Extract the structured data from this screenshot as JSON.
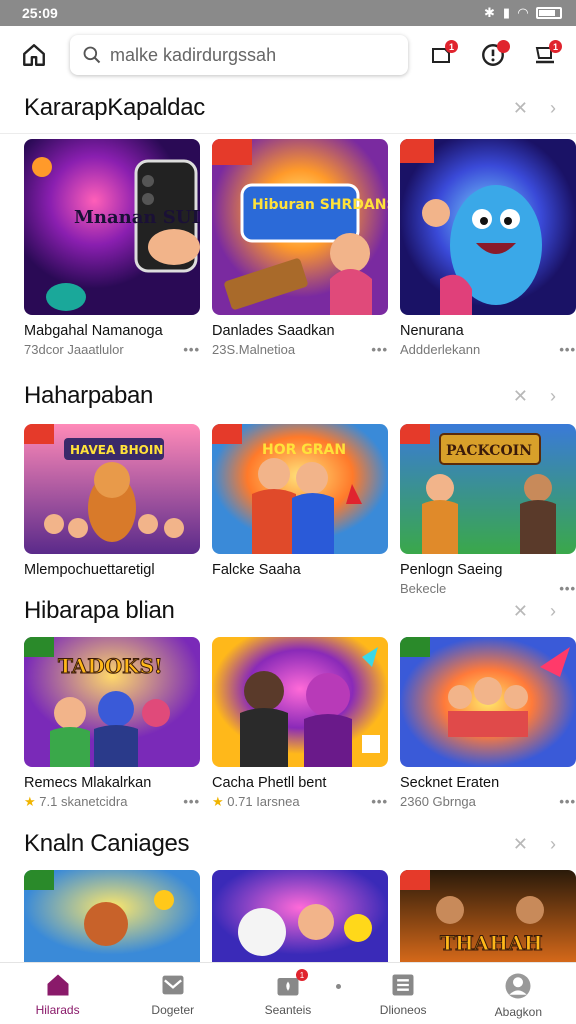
{
  "status_bar": {
    "time": "25:09"
  },
  "search": {
    "placeholder": "malke kadirdurgssah"
  },
  "top_actions": [
    {
      "icon": "inbox-icon",
      "badge": "1"
    },
    {
      "icon": "notification-icon",
      "badge": ""
    },
    {
      "icon": "cart-icon",
      "badge": "1"
    }
  ],
  "sections": [
    {
      "title": "KararapKapaldac",
      "cards": [
        {
          "title": "Mabgahal Namanoga",
          "meta": "73dcor Jaaatlulor",
          "badge_text": "Mnanan SUDAICI"
        },
        {
          "title": "Danlades Saadkan",
          "meta": "23S.Malnetioa",
          "badge_text": "Hiburan SHRDANS"
        },
        {
          "title": "Nenurana",
          "meta": "Addderlekann",
          "badge_text": ""
        }
      ]
    },
    {
      "title": "Haharpaban",
      "cards": [
        {
          "title": "Mlempochuettaretigl",
          "meta": "",
          "badge_text": "HAVEA BHOIN"
        },
        {
          "title": "Falcke Saaha",
          "meta": "",
          "badge_text": "HOR GRAN"
        },
        {
          "title": "Penlogn Saeing",
          "meta": "Bekecle",
          "badge_text": "PACKCOIN"
        }
      ]
    },
    {
      "title": "Hibarapa blian",
      "cards": [
        {
          "title": "Remecs Mlakalrkan",
          "meta": "7.1 skanetcidra",
          "rating": true,
          "badge_text": "TADOKS!"
        },
        {
          "title": "Cacha Phetll bent",
          "meta": "0.71 Iarsnea",
          "rating": true,
          "badge_text": ""
        },
        {
          "title": "Secknet Eraten",
          "meta": "2360 Gbrnga",
          "badge_text": ""
        }
      ]
    },
    {
      "title": "Knaln Caniages",
      "cards": [
        {
          "title": "",
          "meta": "",
          "badge_text": ""
        },
        {
          "title": "",
          "meta": "",
          "badge_text": ""
        },
        {
          "title": "",
          "meta": "",
          "badge_text": "THAHAH"
        }
      ]
    }
  ],
  "bottom_nav": [
    {
      "label": "Hilarads",
      "icon": "home-icon",
      "active": true
    },
    {
      "label": "Dogeter",
      "icon": "mail-icon"
    },
    {
      "label": "Seanteis",
      "icon": "bag-icon",
      "badge": "1"
    },
    {
      "label": "Dlioneos",
      "icon": "list-icon"
    },
    {
      "label": "Abagkon",
      "icon": "profile-icon"
    }
  ],
  "colors": {
    "accent": "#8a1a6a",
    "badge_red": "#e0242e",
    "status_bar": "#8a8a8a"
  }
}
